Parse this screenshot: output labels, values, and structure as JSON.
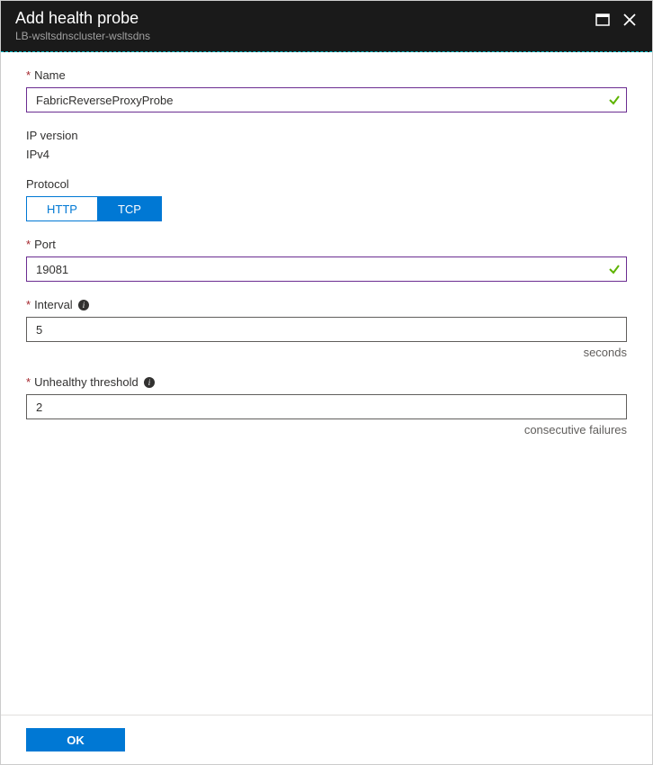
{
  "header": {
    "title": "Add health probe",
    "subtitle": "LB-wsltsdnscluster-wsltsdns"
  },
  "fields": {
    "name": {
      "label": "Name",
      "value": "FabricReverseProxyProbe"
    },
    "ip_version": {
      "label": "IP version",
      "value": "IPv4"
    },
    "protocol": {
      "label": "Protocol",
      "options": [
        "HTTP",
        "TCP"
      ],
      "selected": "TCP"
    },
    "port": {
      "label": "Port",
      "value": "19081"
    },
    "interval": {
      "label": "Interval",
      "value": "5",
      "unit": "seconds"
    },
    "threshold": {
      "label": "Unhealthy threshold",
      "value": "2",
      "unit": "consecutive failures"
    }
  },
  "footer": {
    "ok": "OK"
  }
}
